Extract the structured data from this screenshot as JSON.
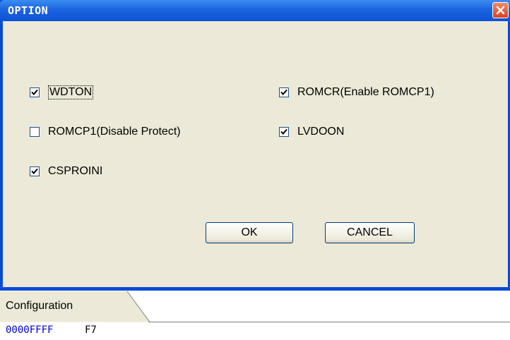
{
  "dialog": {
    "title": "OPTION",
    "checkboxes": [
      {
        "label": "WDTON",
        "checked": true
      },
      {
        "label": "ROMCR(Enable ROMCP1)",
        "checked": true
      },
      {
        "label": "ROMCP1(Disable Protect)",
        "checked": false
      },
      {
        "label": "LVDOON",
        "checked": true
      },
      {
        "label": "CSPROINI",
        "checked": true
      }
    ],
    "ok_label": "OK",
    "cancel_label": "CANCEL"
  },
  "bottom_panel": {
    "tab_label": "Configuration",
    "address": "0000FFFF",
    "value": "F7"
  },
  "colors": {
    "title_bar": "#1c64e0",
    "dialog_bg": "#ece9d8",
    "close_button": "#d8421e",
    "address_text": "#0000cc"
  }
}
